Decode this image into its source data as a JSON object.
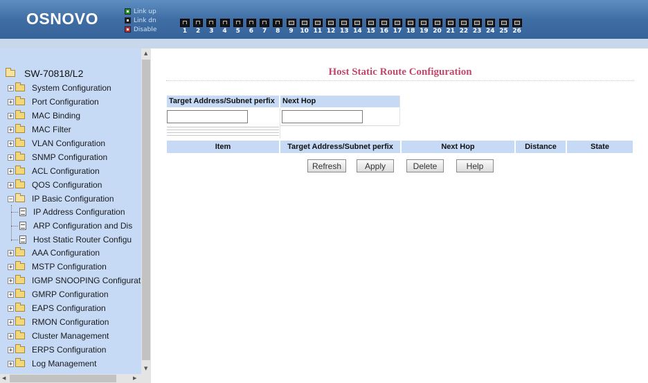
{
  "header": {
    "logo": "OSNOVO",
    "legend": {
      "link_up": "Link up",
      "link_dn": "Link dn",
      "disable": "Disable"
    },
    "ports": [
      "1",
      "2",
      "3",
      "4",
      "5",
      "6",
      "7",
      "8",
      "9",
      "10",
      "11",
      "12",
      "13",
      "14",
      "15",
      "16",
      "17",
      "18",
      "19",
      "20",
      "21",
      "22",
      "23",
      "24",
      "25",
      "26"
    ]
  },
  "sidebar": {
    "root": "SW-70818/L2",
    "items": [
      "System Configuration",
      "Port Configuration",
      "MAC Binding",
      "MAC Filter",
      "VLAN Configuration",
      "SNMP Configuration",
      "ACL Configuration",
      "QOS Configuration",
      "IP Basic Configuration",
      "AAA Configuration",
      "MSTP Configuration",
      "IGMP SNOOPING Configurat",
      "GMRP Configuration",
      "EAPS Configuration",
      "RMON Configuration",
      "Cluster Management",
      "ERPS Configuration",
      "Log Management"
    ],
    "subitems": [
      "IP Address Configuration",
      "ARP Configuration and Dis",
      "Host Static Router Configu"
    ]
  },
  "main": {
    "title": "Host Static Route Configuration",
    "form": {
      "target_label": "Target Address/Subnet perfix",
      "nexthop_label": "Next Hop",
      "target_value": "",
      "nexthop_value": ""
    },
    "table": {
      "headers": [
        "Item",
        "Target Address/Subnet perfix",
        "Next Hop",
        "Distance",
        "State"
      ]
    },
    "buttons": {
      "refresh": "Refresh",
      "apply": "Apply",
      "delete": "Delete",
      "help": "Help"
    }
  }
}
